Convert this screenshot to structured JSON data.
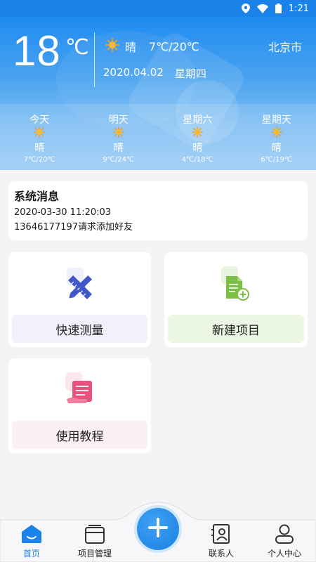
{
  "status_bar": {
    "time": "1:21",
    "icons": [
      "location-icon",
      "wifi-icon",
      "battery-icon"
    ]
  },
  "weather": {
    "current_temp": "18",
    "unit": "℃",
    "condition": "晴",
    "range": "7℃/20℃",
    "date": "2020.04.02",
    "weekday": "星期四",
    "city": "北京市",
    "forecast": [
      {
        "day": "今天",
        "condition": "晴",
        "range": "7℃/20℃"
      },
      {
        "day": "明天",
        "condition": "晴",
        "range": "9℃/24℃"
      },
      {
        "day": "星期六",
        "condition": "晴",
        "range": "4℃/18℃"
      },
      {
        "day": "星期天",
        "condition": "晴",
        "range": "6℃/19℃"
      }
    ]
  },
  "message": {
    "title": "系统消息",
    "time": "2020-03-30 11:20:03",
    "text": "13646177197请求添加好友"
  },
  "features": [
    {
      "label": "快速测量",
      "icon": "ruler-pencil-icon"
    },
    {
      "label": "新建项目",
      "icon": "new-document-icon"
    },
    {
      "label": "使用教程",
      "icon": "tutorial-icon"
    }
  ],
  "nav": {
    "items": [
      {
        "label": "首页",
        "icon": "home-icon",
        "active": true
      },
      {
        "label": "项目管理",
        "icon": "project-icon"
      },
      {
        "label": "联系人",
        "icon": "contacts-icon"
      },
      {
        "label": "个人中心",
        "icon": "profile-icon"
      }
    ],
    "fab_icon": "plus-icon"
  },
  "colors": {
    "accent": "#1a82e8",
    "pink": "#e9527f",
    "green": "#7bbf45"
  }
}
